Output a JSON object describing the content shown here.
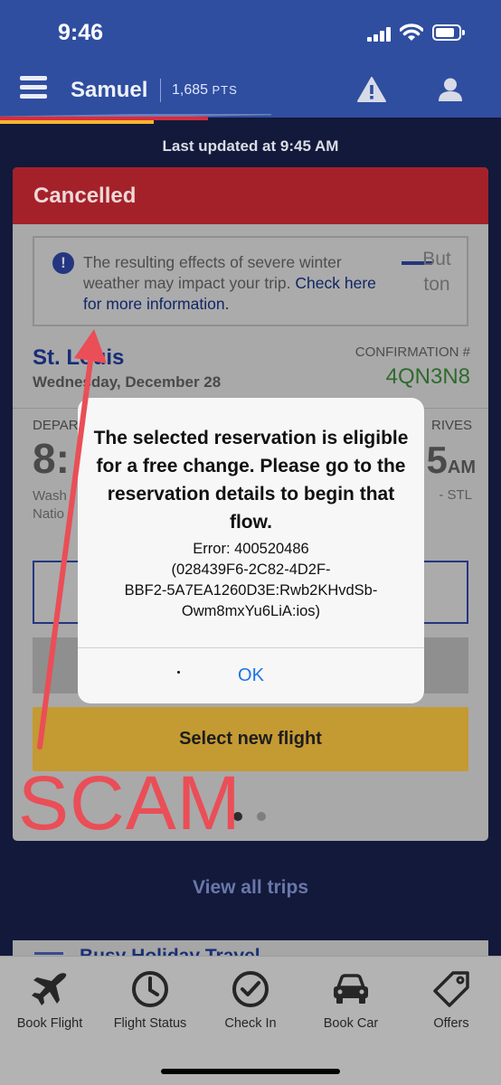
{
  "status_bar": {
    "time": "9:46"
  },
  "header": {
    "user_name": "Samuel",
    "points": "1,685",
    "points_unit": "PTS"
  },
  "last_updated": "Last updated at 9:45 AM",
  "trip_card": {
    "status": "Cancelled",
    "notice": {
      "text": "The resulting effects of severe winter weather may impact your trip.",
      "link": "Check here for more information.",
      "button_line_1": "But",
      "button_line_2": "ton"
    },
    "city": "St. Louis",
    "date": "Wednesday, December 28",
    "confirmation_label": "CONFIRMATION #",
    "confirmation_code": "4QN3N8",
    "depart_label": "DEPART",
    "depart_time": "8:",
    "depart_airport_line_1": "Wash",
    "depart_airport_line_2": "Natio",
    "arrive_label": "RIVES",
    "arrive_time": "5",
    "arrive_period": "AM",
    "arrive_airport": "- STL",
    "select_new_flight": "Select new flight"
  },
  "view_all_trips": "View all trips",
  "promo_title": "Busy Holiday Travel",
  "dialog": {
    "title": "The selected reservation is eligible for a free change. Please go to the reservation details to begin that flow.",
    "error_line_1": "Error: 400520486",
    "error_line_2": "(028439F6-2C82-4D2F-",
    "error_line_3": "BBF2-5A7EA1260D3E:Rwb2KHvdSb-",
    "error_line_4": "Owm8mxYu6LiA:ios)",
    "ok_label": "OK"
  },
  "annotation": {
    "text": "SCAM",
    "color": "#ea4e57"
  },
  "tabs": [
    {
      "label": "Book Flight",
      "icon": "airplane-icon"
    },
    {
      "label": "Flight Status",
      "icon": "clock-icon"
    },
    {
      "label": "Check In",
      "icon": "check-circle-icon"
    },
    {
      "label": "Book Car",
      "icon": "car-icon"
    },
    {
      "label": "Offers",
      "icon": "tag-icon"
    }
  ],
  "colors": {
    "header_blue": "#2f4ea0",
    "cancelled_red": "#a52129",
    "confirmation_green": "#2e6b2c",
    "select_button_gold": "#c49a32",
    "ok_blue": "#1a73e8",
    "stripe_red": "#d92c3c",
    "stripe_yellow": "#f4b630"
  }
}
